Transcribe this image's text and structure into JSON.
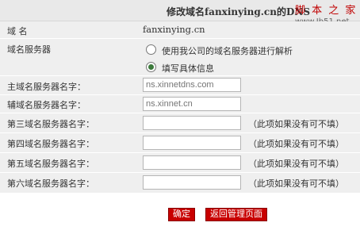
{
  "header": {
    "title": "修改域名fanxinying.cn的DNS",
    "watermark_top": "脚 本 之 家",
    "watermark_bottom": "www.Jb51.net"
  },
  "form": {
    "domain_label": "域  名",
    "domain_value": "fanxinying.cn",
    "dns_server_label": "域名服务器",
    "radio_option_company": "使用我公司的域名服务器进行解析",
    "radio_option_custom": "填写具体信息",
    "primary_label": "主域名服务器名字：",
    "primary_placeholder": "ns.xinnetdns.com",
    "secondary_label": "辅域名服务器名字：",
    "secondary_placeholder": "ns.xinnet.cn",
    "third_label": "第三域名服务器名字：",
    "fourth_label": "第四域名服务器名字：",
    "fifth_label": "第五域名服务器名字：",
    "sixth_label": "第六域名服务器名字：",
    "optional_hint": "（此项如果没有可不填）"
  },
  "buttons": {
    "confirm": "确定",
    "back": "返回管理页面"
  },
  "colors": {
    "button_red": "#c80000",
    "row_bg": "#efefef",
    "header_bg": "#e9e9e9",
    "watermark": "#c00000"
  }
}
